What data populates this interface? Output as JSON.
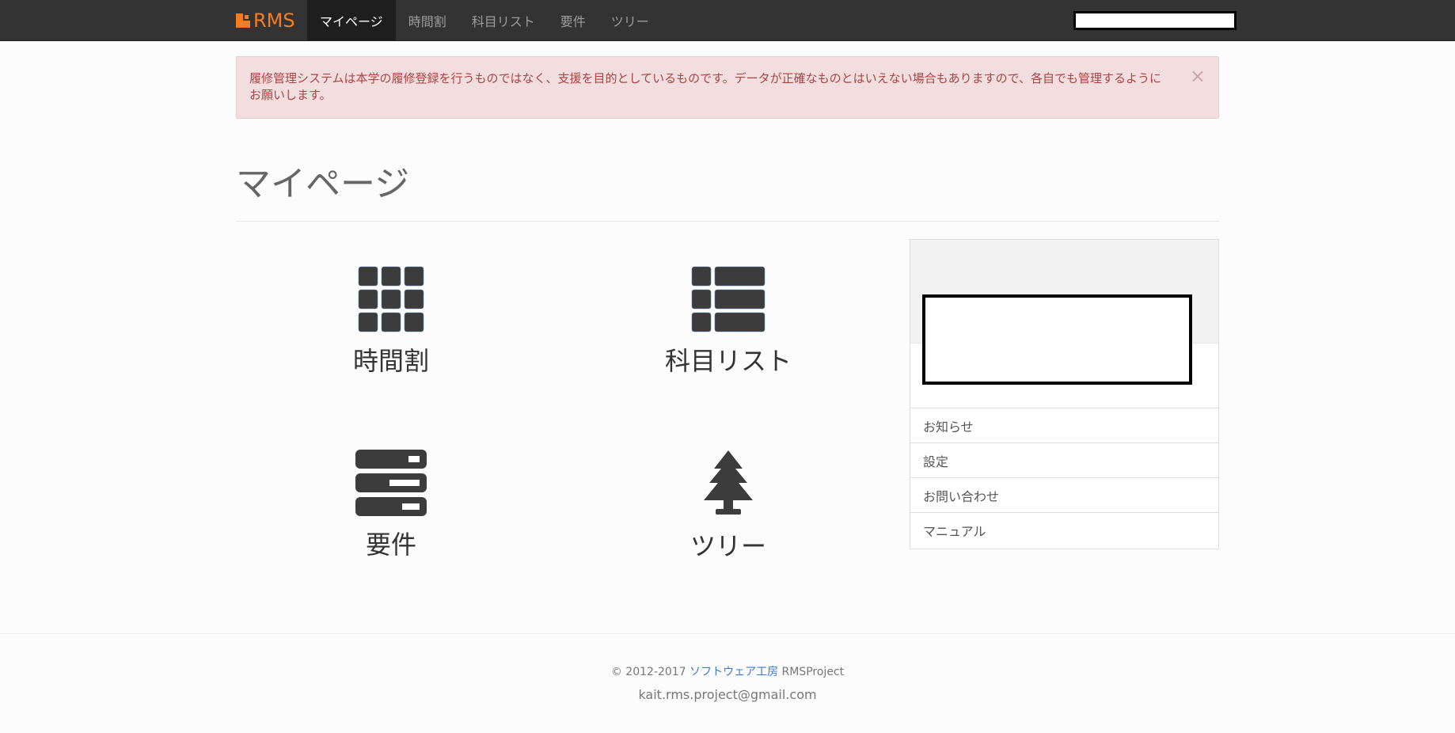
{
  "navbar": {
    "brand": "RMS",
    "items": [
      {
        "label": "マイページ",
        "active": true
      },
      {
        "label": "時間割"
      },
      {
        "label": "科目リスト"
      },
      {
        "label": "要件"
      },
      {
        "label": "ツリー"
      }
    ]
  },
  "alert": {
    "text": "履修管理システムは本学の履修登録を行うものではなく、支援を目的としているものです。データが正確なものとはいえない場合もありますので、各自でも管理するようにお願いします。",
    "close": "×"
  },
  "page": {
    "title": "マイページ"
  },
  "tiles": [
    {
      "label": "時間割",
      "icon": "grid-icon"
    },
    {
      "label": "科目リスト",
      "icon": "list-icon"
    },
    {
      "label": "要件",
      "icon": "server-icon"
    },
    {
      "label": "ツリー",
      "icon": "tree-icon"
    }
  ],
  "panel": {
    "items": [
      {
        "label": "お知らせ"
      },
      {
        "label": "設定"
      },
      {
        "label": "お問い合わせ"
      },
      {
        "label": "マニュアル"
      }
    ]
  },
  "footer": {
    "copyright_prefix": "© 2012-2017 ",
    "company_link": "ソフトウェア工房",
    "copyright_suffix": " RMSProject",
    "email": "kait.rms.project@gmail.com"
  },
  "colors": {
    "navbar_bg": "#333333",
    "brand": "#f47d20",
    "alert_bg": "#f2dede",
    "alert_text": "#a94442",
    "icon": "#3c3c3c",
    "link": "#3a7bc8"
  }
}
